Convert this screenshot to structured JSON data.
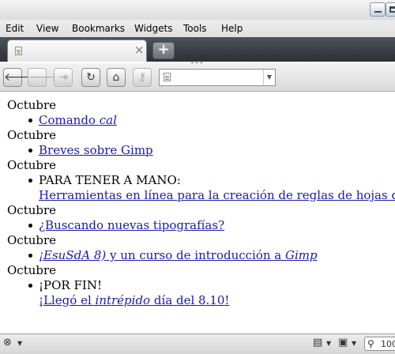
{
  "menubar": {
    "items": [
      "Edit",
      "View",
      "Bookmarks",
      "Widgets",
      "Tools",
      "Help"
    ]
  },
  "tab": {
    "close_label": "×"
  },
  "newtab": {
    "label": "+"
  },
  "navbar": {
    "url_value": "",
    "buttons": {
      "back": "🡐",
      "forward": "🡒",
      "fastforward": "⇥",
      "reload": "↻",
      "home": "⌂",
      "wand": "⚷"
    },
    "url_dropdown": "▼"
  },
  "content": {
    "sections": [
      {
        "month": "Octubre",
        "items": [
          {
            "line1_link": "Comando ",
            "line1_link_em": "cal"
          }
        ]
      },
      {
        "month": "Octubre",
        "items": [
          {
            "line1_link": "Breves sobre Gimp"
          }
        ]
      },
      {
        "month": "Octubre",
        "items": [
          {
            "line1_text": "PARA TENER A MANO:",
            "line2_link": "Herramientas en línea para la creación de reglas de hojas de estilo (CSS)"
          }
        ]
      },
      {
        "month": "Octubre",
        "items": [
          {
            "line1_link": "¿Buscando nuevas tipografías?"
          }
        ]
      },
      {
        "month": "Octubre",
        "items": [
          {
            "link_em": "¡EsuSdA 8)",
            "link_rest": " y un curso de introducción a ",
            "link_em2": "Gimp"
          }
        ]
      },
      {
        "month": "Octubre",
        "items": [
          {
            "line1_text": "¡POR FIN!",
            "line2_link_a": "¡Llegó el ",
            "line2_link_em": "intrépido",
            "line2_link_b": " día del 8.10!"
          }
        ]
      }
    ]
  },
  "statusbar": {
    "zoom_value": "100"
  },
  "colors": {
    "link": "#1a1ab0",
    "tabstrip": "#3a3f46"
  },
  "icons": [
    "page-icon",
    "back-icon",
    "forward-icon",
    "fastforward-icon",
    "reload-icon",
    "home-icon",
    "wand-icon",
    "stop-icon",
    "file-icon",
    "image-icon",
    "search-icon"
  ]
}
